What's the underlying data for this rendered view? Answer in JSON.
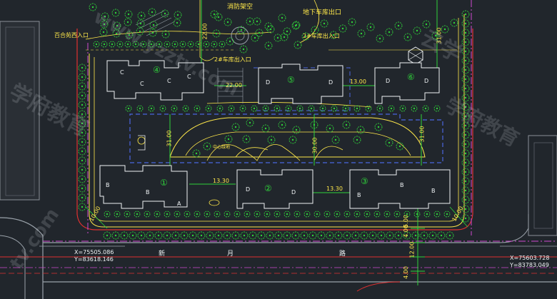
{
  "colors": {
    "background": "#21262c",
    "yellow": "#ffe84a",
    "green": "#2fd23a",
    "magenta": "#d04ad0",
    "red": "#e03030",
    "cyan": "#30c8e0",
    "blue": "#4a66e0",
    "white": "#eef2f4"
  },
  "labels": {
    "fire_access_top": "消防架空",
    "underground_garage": "地下车库出口",
    "entry_left": "百合苑西入口",
    "entry_north": "2#车库出入口",
    "entry_center": "2#车库出入口",
    "road_name_1": "新",
    "road_name_2": "月",
    "road_name_3": "路",
    "plaza_label": "中心绿地"
  },
  "dimensions": {
    "d_22_top": "22.00",
    "d_31_right": "31.00",
    "d_22_mid": "22.00",
    "d_13_top": "13.00",
    "d_31_left": "31.00",
    "d_30_center": "30.00",
    "d_31_rightmid": "31.00",
    "d_13_30_left": "13.30",
    "d_13_30_right": "13.30",
    "d_10_left": "10.00",
    "d_10_right": "10.00",
    "d_4_00_a": "4.00",
    "d_5_00": "5.00",
    "d_12_00": "12.00",
    "d_4_00_b": "4.00"
  },
  "coordinates": {
    "left_x": "X=75505.086",
    "left_y": "Y=83618.146",
    "right_x": "X=75603.728",
    "right_y": "Y=83783.049"
  },
  "building_numbers": [
    "④",
    "⑤",
    "⑥",
    "①",
    "②",
    "③"
  ],
  "unit_letters": [
    "C",
    "A",
    "B",
    "D"
  ],
  "watermarks": [
    "www.yzztv.com",
    "学府教育",
    "云学",
    "学府教育",
    "tv.com"
  ]
}
